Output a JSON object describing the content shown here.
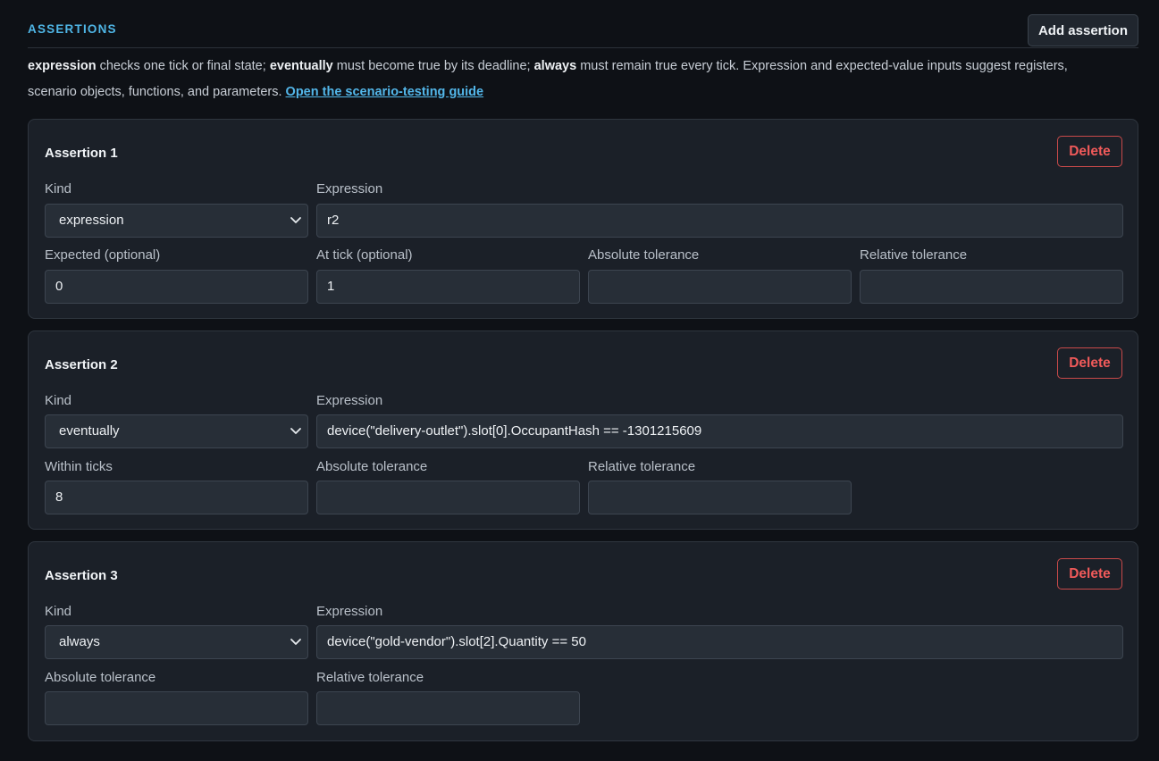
{
  "section": {
    "title": "ASSERTIONS",
    "add_label": "Add assertion"
  },
  "help": {
    "t1": "expression",
    "t2": " checks one tick or final state; ",
    "t3": "eventually",
    "t4": " must become true by its deadline; ",
    "t5": "always",
    "t6": " must remain true every tick. Expression and expected-value inputs suggest registers, scenario objects, functions, and parameters. ",
    "link": "Open the scenario-testing guide"
  },
  "assertions": [
    {
      "title": "Assertion 1",
      "delete_label": "Delete",
      "kind_label": "Kind",
      "kind": "expression",
      "expression_label": "Expression",
      "expression": "r2",
      "expected_label": "Expected (optional)",
      "expected": "0",
      "at_tick_label": "At tick (optional)",
      "at_tick": "1",
      "abs_label": "Absolute tolerance",
      "abs": "",
      "rel_label": "Relative tolerance",
      "rel": ""
    },
    {
      "title": "Assertion 2",
      "delete_label": "Delete",
      "kind_label": "Kind",
      "kind": "eventually",
      "expression_label": "Expression",
      "expression": "device(\"delivery-outlet\").slot[0].OccupantHash == -1301215609",
      "within_label": "Within ticks",
      "within": "8",
      "abs_label": "Absolute tolerance",
      "abs": "",
      "rel_label": "Relative tolerance",
      "rel": ""
    },
    {
      "title": "Assertion 3",
      "delete_label": "Delete",
      "kind_label": "Kind",
      "kind": "always",
      "expression_label": "Expression",
      "expression": "device(\"gold-vendor\").slot[2].Quantity == 50",
      "abs_label": "Absolute tolerance",
      "abs": "",
      "rel_label": "Relative tolerance",
      "rel": ""
    }
  ],
  "colors": {
    "accent": "#4fb6e6",
    "danger": "#f05a5a",
    "background": "#0e1116",
    "card": "#1b2028"
  }
}
